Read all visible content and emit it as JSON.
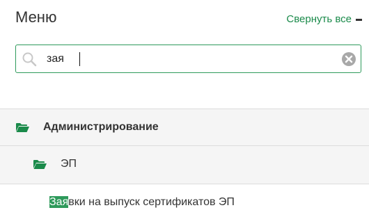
{
  "header": {
    "title": "Меню",
    "collapse_label": "Свернуть все"
  },
  "search": {
    "value": "зая",
    "placeholder": ""
  },
  "menu": {
    "group": {
      "label": "Администрирование"
    },
    "subgroup": {
      "label": "ЭП"
    },
    "item": {
      "highlight": "Зая",
      "rest": "вки на выпуск сертификатов ЭП"
    }
  },
  "colors": {
    "accent": "#2e9a5b",
    "row_background": "#f5f5f5",
    "text": "#333333"
  },
  "icons": [
    "search-icon",
    "clear-icon",
    "folder-open-icon",
    "minus-icon"
  ]
}
